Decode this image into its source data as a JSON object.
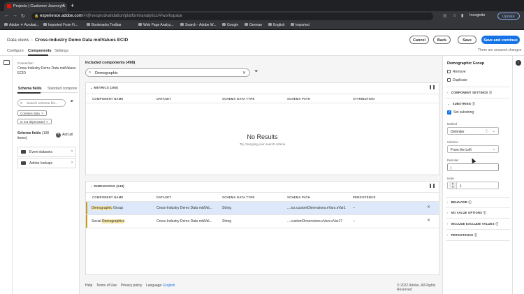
{
  "browser": {
    "tab_title": "Projects | Customer Journey A",
    "new_tab": "+",
    "url_host": "experience.adobe.com",
    "url_path": "/#/@sesprodvalidation/platform/analytics/#/workspace",
    "incognito_label": "Incognito",
    "update_label": "Update",
    "bookmarks": [
      "Adobe ☀ Acrobat...",
      "Imported From Fi...",
      "Bookmarks Toolbar",
      "Web Page Analyz...",
      "Search - Adobe W...",
      "Google",
      "German",
      "English",
      "Imported"
    ]
  },
  "header": {
    "breadcrumb_root": "Data views",
    "breadcrumb_current": "Cross-Industry Demo Data midValues ECID",
    "tabs": [
      "Configure",
      "Components",
      "Settings"
    ],
    "cancel_label": "Cancel",
    "back_label": "Back",
    "save_label": "Save",
    "save_continue_label": "Save and continue",
    "unsaved_text": "There are unsaved changes"
  },
  "left_panel": {
    "connection_label": "Connection",
    "connection_name": "Cross-Industry Demo Data midValues ECID",
    "tabs": [
      "Schema fields",
      "Standard compone"
    ],
    "search_placeholder": "Search schema fiel...",
    "tags": [
      "Contains data",
      "Is not deprecated"
    ],
    "schema_fields_title": "Schema fields",
    "schema_fields_count": "(108",
    "schema_fields_count2": "items)",
    "add_all_label": "Add all",
    "items": [
      "Event datasets",
      "Adobe lookups"
    ]
  },
  "center": {
    "included_title": "Included components (498)",
    "search_value": "Demographic",
    "metrics_title": "METRICS (250)",
    "metrics_columns": [
      "COMPONENT NAME",
      "DATASET",
      "SCHEMA DATA TYPE",
      "SCHEMA PATH",
      "ATTRIBUTION"
    ],
    "no_results": "No Results",
    "no_results_sub": "Try changing your search criteria",
    "dimensions_title": "DIMENSIONS (248)",
    "dimensions_columns": [
      "COMPONENT NAME",
      "DATASET",
      "SCHEMA DATA TYPE",
      "SCHEMA PATH",
      "PERSISTENCE"
    ],
    "rows": [
      {
        "name_hl": "Demographic",
        "name_rest": " Group",
        "dataset": "Cross-Industry Demo Data midVal...",
        "type": "String",
        "path": "....ics.customDimensions.eVars.eVar1",
        "persistence": "--"
      },
      {
        "name_pre": "Social ",
        "name_hl": "Demographics",
        "dataset": "Cross-Industry Demo Data midVal...",
        "type": "String",
        "path": "....customDimensions.eVars.eVar17",
        "persistence": "--"
      }
    ],
    "footer_links": [
      "Help",
      "Terms of Use",
      "Privacy policy"
    ],
    "language_label": "Language:",
    "language_value": "English",
    "copyright": "© 2022 Adobe. All Rights Reserved"
  },
  "right_panel": {
    "title": "Demographic Group",
    "remove_label": "Remove",
    "duplicate_label": "Duplicate",
    "sections": [
      "COMPONENT SETTINGS",
      "SUBSTRING",
      "BEHAVIOR",
      "NO VALUE OPTIONS",
      "INCLUDE EXCLUDE VALUES",
      "PERSISTENCE"
    ],
    "set_substring_label": "Set substring",
    "method_label": "Method",
    "method_value": "Delimiter",
    "criterion_label": "Criterion",
    "criterion_value": "From the Left",
    "delimiter_label": "Delimiter",
    "delimiter_value": "|",
    "index_label": "Index",
    "index_value": "1"
  },
  "colors": {
    "accent": "#1473e6",
    "highlight": "#f6e6a6",
    "selected_row": "#dde9fa"
  }
}
